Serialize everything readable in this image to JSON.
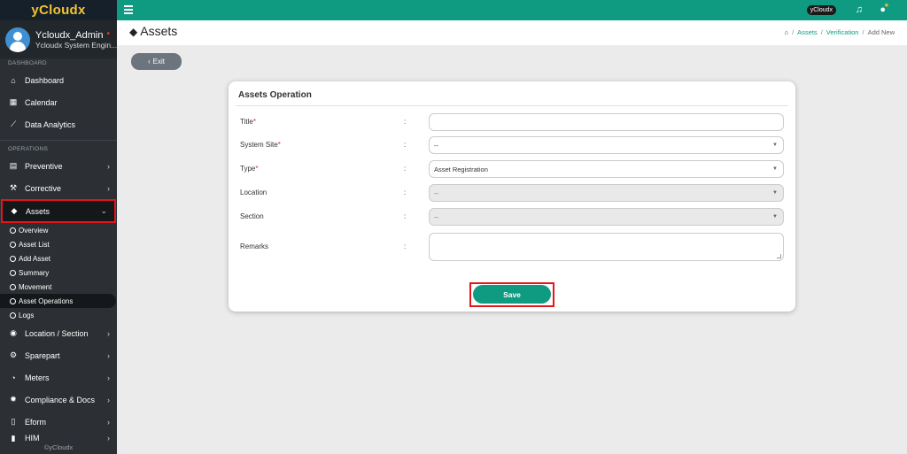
{
  "brand": {
    "name": "yCloudx"
  },
  "profile": {
    "name": "Ycloudx_Admin",
    "status_dot": "•",
    "role": "Ycloudx System Engin..."
  },
  "sidebar": {
    "section_dashboard": "DASHBOARD",
    "section_operations": "OPERATIONS",
    "top_items": [
      {
        "label": "Dashboard",
        "icon": "home-icon"
      },
      {
        "label": "Calendar",
        "icon": "calendar-icon"
      },
      {
        "label": "Data Analytics",
        "icon": "line-chart-icon"
      }
    ],
    "ops_items": [
      {
        "label": "Preventive",
        "icon": "calendar-grid-icon"
      },
      {
        "label": "Corrective",
        "icon": "wrench-icon"
      },
      {
        "label": "Assets",
        "icon": "tag-icon",
        "active": true
      }
    ],
    "assets_sub": [
      {
        "label": "Overview"
      },
      {
        "label": "Asset List"
      },
      {
        "label": "Add Asset"
      },
      {
        "label": "Summary"
      },
      {
        "label": "Movement"
      },
      {
        "label": "Asset Operations",
        "active": true
      },
      {
        "label": "Logs"
      }
    ],
    "more_items": [
      {
        "label": "Location / Section",
        "icon": "globe-icon"
      },
      {
        "label": "Sparepart",
        "icon": "sparepart-icon"
      },
      {
        "label": "Meters",
        "icon": "meter-icon"
      },
      {
        "label": "Compliance & Docs",
        "icon": "gear-icon"
      },
      {
        "label": "Eform",
        "icon": "form-icon"
      },
      {
        "label": "HIM",
        "icon": "him-icon"
      }
    ],
    "footer": "©yCloudx"
  },
  "topbar": {
    "tenant": "yCloudx"
  },
  "header": {
    "title": "Assets",
    "breadcrumb": [
      "Assets",
      "Verification",
      "Add New"
    ]
  },
  "exit_label": "Exit",
  "form": {
    "title": "Assets Operation",
    "fields": [
      {
        "label": "Title",
        "required": true,
        "value": "",
        "kind": "text"
      },
      {
        "label": "System Site",
        "required": true,
        "value": "--",
        "kind": "select"
      },
      {
        "label": "Type",
        "required": true,
        "value": "Asset Registration",
        "kind": "select"
      },
      {
        "label": "Location",
        "required": false,
        "value": "--",
        "kind": "select-disabled"
      },
      {
        "label": "Section",
        "required": false,
        "value": "--",
        "kind": "select-disabled"
      },
      {
        "label": "Remarks",
        "required": false,
        "value": "",
        "kind": "textarea"
      }
    ],
    "colon": ":",
    "required_mark": "*",
    "save_label": "Save"
  },
  "colors": {
    "accent": "#0f9a82",
    "sidebar": "#2c3034",
    "highlight": "#e3161b",
    "brand": "#f2c430"
  }
}
